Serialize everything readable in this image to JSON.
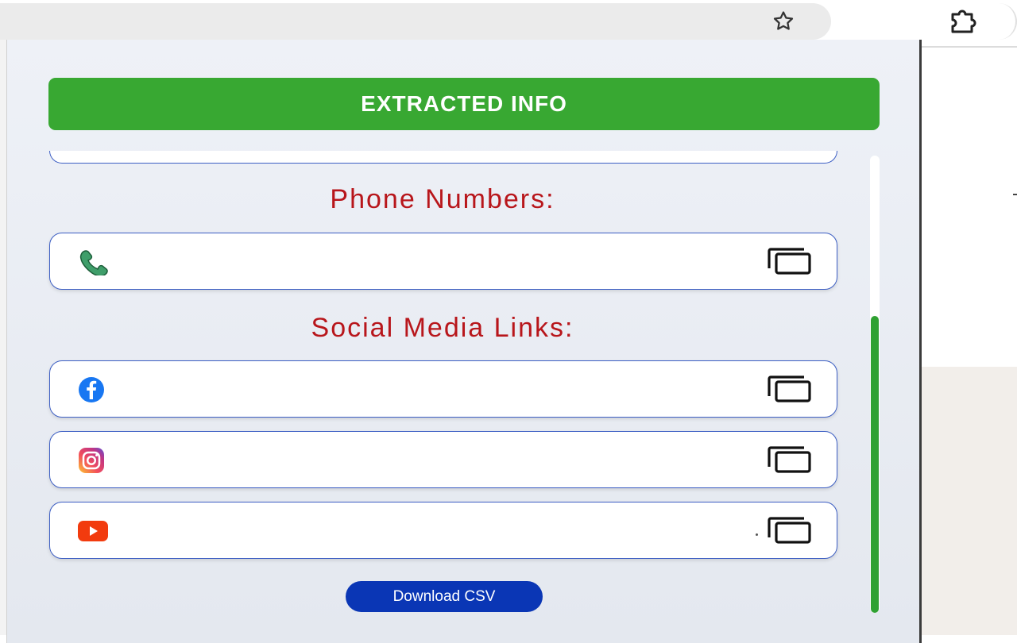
{
  "popup": {
    "header": {
      "title": "EXTRACTED INFO"
    },
    "phone_section": {
      "title": "Phone Numbers:",
      "items": [
        {
          "icon": "phone-icon",
          "value": ""
        }
      ]
    },
    "social_section": {
      "title": "Social Media Links:",
      "items": [
        {
          "icon": "facebook-icon",
          "value": ""
        },
        {
          "icon": "instagram-icon",
          "value": ""
        },
        {
          "icon": "youtube-icon",
          "value": ""
        }
      ]
    },
    "download_button": {
      "label": "Download CSV"
    }
  },
  "colors": {
    "header_green": "#38a832",
    "section_title_red": "#b8161b",
    "card_border_blue": "#3d5fc4",
    "download_blue": "#0a36b5",
    "scrollbar_green": "#2fa132"
  },
  "browser": {
    "star_icon": "★",
    "extension_icon": "puzzle-piece-icon"
  }
}
